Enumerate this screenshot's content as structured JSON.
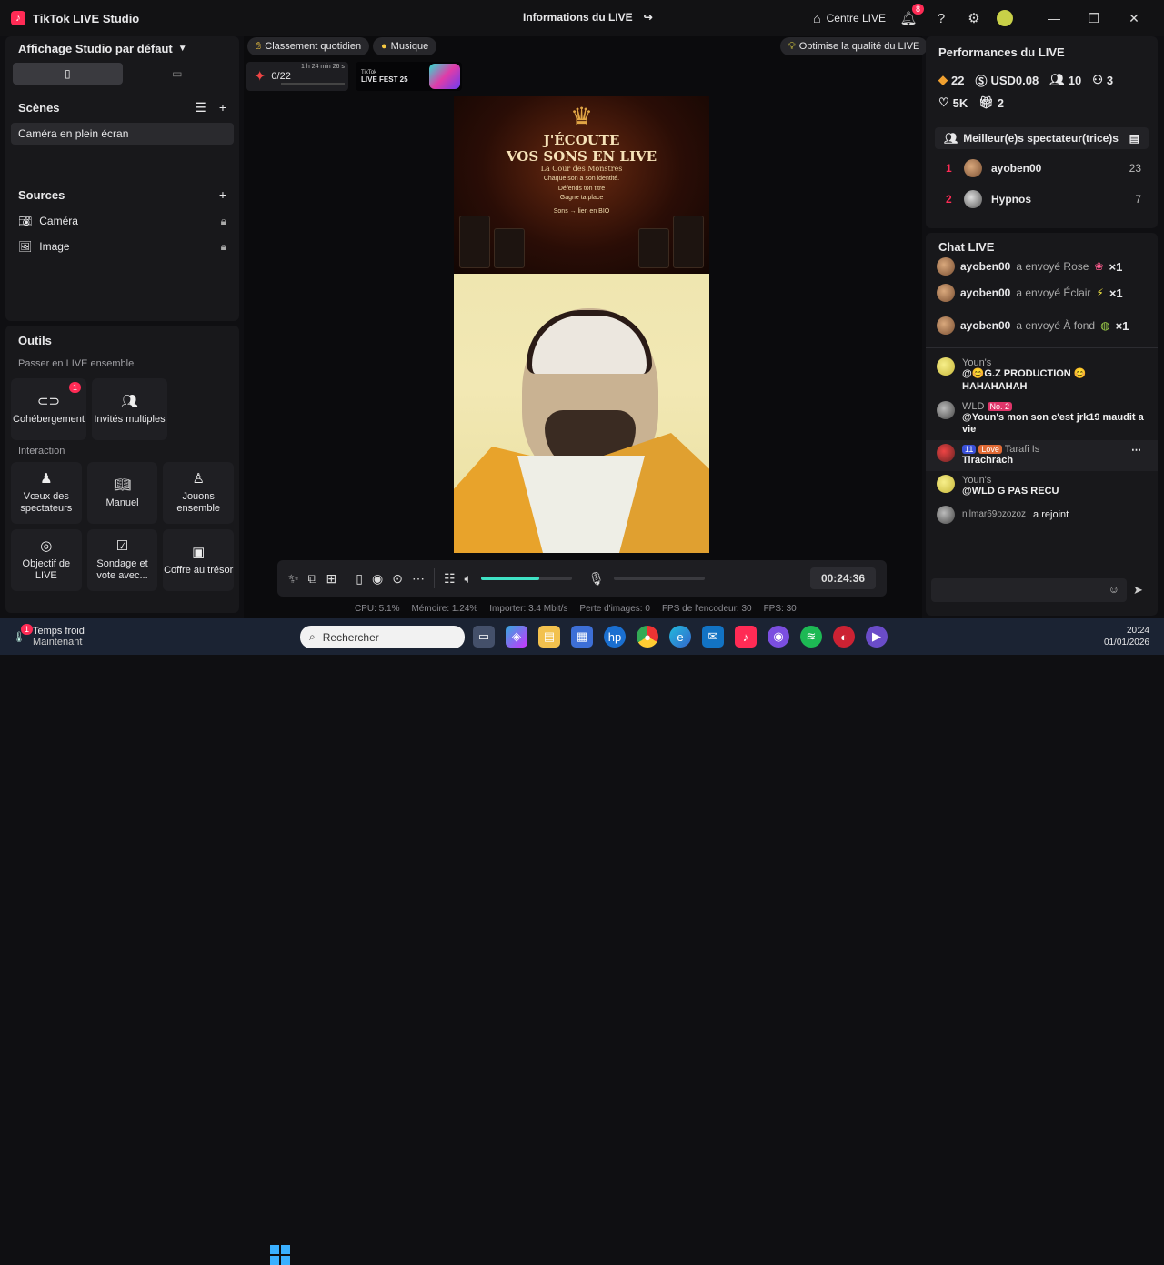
{
  "app": {
    "title": "TikTok LIVE Studio",
    "live_info": "Informations du LIVE",
    "centre": "Centre LIVE",
    "notif_count": "8"
  },
  "left": {
    "layout_title": "Affichage Studio par défaut",
    "scenes_title": "Scènes",
    "scene_active": "Caméra en plein écran",
    "sources_title": "Sources",
    "sources": [
      "Caméra",
      "Image"
    ],
    "tools_title": "Outils",
    "tools_sub1": "Passer en LIVE ensemble",
    "tools_sub2": "Interaction",
    "tiles1": [
      "Cohébergement",
      "Invités multiples"
    ],
    "cohost_badge": "1",
    "tiles2": [
      "Vœux des spectateurs",
      "Manuel",
      "Jouons ensemble"
    ],
    "tiles3": [
      "Objectif de LIVE",
      "Sondage et vote avec...",
      "Coffre au trésor"
    ]
  },
  "center": {
    "chip1": "Classement quotidien",
    "chip2": "Musique",
    "chip3": "Optimise la qualité du LIVE",
    "ranking": "0/22",
    "ranking_time": "1 h 24 min 26 s",
    "fest": "LIVE FEST 25",
    "fest_small": "TikTok",
    "poster_title1": "J'ÉCOUTE",
    "poster_title2": "VOS SONS EN LIVE",
    "poster_sub": "La Cour des Monstres",
    "poster_lines": [
      "Chaque son a son identité.",
      "Défends ton titre",
      "Gagne ta place",
      "Sons → lien en BIO"
    ],
    "timer": "00:24:36",
    "volume_level": 0.64,
    "stats": [
      "CPU: 5.1%",
      "Mémoire: 1.24%",
      "Importer: 3.4 Mbit/s",
      "Perte d'images: 0",
      "FPS de l'encodeur: 30",
      "FPS: 30"
    ]
  },
  "right": {
    "perf_title": "Performances du LIVE",
    "perf1": [
      "22",
      "USD0.08",
      "10",
      "3"
    ],
    "perf2": [
      "5K",
      "2"
    ],
    "top_title": "Meilleur(e)s spectateur(trice)s",
    "top": [
      {
        "rank": "1",
        "name": "ayoben00",
        "score": "23"
      },
      {
        "rank": "2",
        "name": "Hypnos",
        "score": "7"
      }
    ],
    "chat_title": "Chat LIVE",
    "gifts": [
      {
        "user": "ayoben00",
        "text": "a envoyé Rose",
        "count": "×1"
      },
      {
        "user": "ayoben00",
        "text": "a envoyé Éclair",
        "count": "×1"
      },
      {
        "user": "ayoben00",
        "text": "a envoyé À fond",
        "count": "×1"
      }
    ],
    "messages": [
      {
        "user": "Youn's",
        "text": "@😊G.Z PRODUCTION 😊 HAHAHAHAH"
      },
      {
        "user": "WLD",
        "tag": "No. 2",
        "text": "@Youn's mon son c'est jrk19 maudit a vie"
      },
      {
        "user": "Tarafi Is",
        "level": "11",
        "love": "Love",
        "text": "Tirachrach"
      },
      {
        "user": "Youn's",
        "text": "@WLD G PAS RECU"
      }
    ],
    "join": {
      "user": "nilmar69ozozoz",
      "text": "a rejoint"
    }
  },
  "taskbar": {
    "weather": "Temps froid",
    "weather_sub": "Maintenant",
    "weather_badge": "1",
    "search": "Rechercher",
    "time": "20:24",
    "date": "01/01/2026"
  },
  "colors": {
    "accent": "#ff2b55",
    "teal": "#3fe2c5",
    "panel": "#18181b"
  }
}
